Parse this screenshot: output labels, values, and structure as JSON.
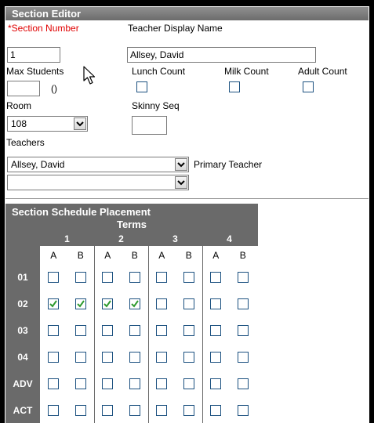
{
  "editor": {
    "title": "Section Editor",
    "section_number_label": "*Section Number",
    "section_number_value": "1",
    "teacher_display_label": "Teacher Display Name",
    "teacher_display_value": "Allsey, David",
    "max_students_label": "Max Students",
    "max_students_value": "",
    "max_students_count": "()",
    "lunch_count_label": "Lunch Count",
    "milk_count_label": "Milk Count",
    "adult_count_label": "Adult Count",
    "room_label": "Room",
    "room_value": "108",
    "skinny_seq_label": "Skinny Seq",
    "skinny_seq_value": "",
    "teachers_label": "Teachers",
    "teacher1_value": "Allsey, David",
    "primary_teacher_label": "Primary Teacher",
    "teacher2_value": ""
  },
  "schedule": {
    "title": "Section Schedule Placement",
    "terms_label": "Terms",
    "terms": [
      "1",
      "2",
      "3",
      "4"
    ],
    "subcols": [
      "A",
      "B",
      "A",
      "B",
      "A",
      "B",
      "A",
      "B"
    ],
    "periods": [
      "01",
      "02",
      "03",
      "04",
      "ADV",
      "ACT"
    ],
    "checked": {
      "01": [
        false,
        false,
        false,
        false,
        false,
        false,
        false,
        false
      ],
      "02": [
        true,
        true,
        true,
        true,
        false,
        false,
        false,
        false
      ],
      "03": [
        false,
        false,
        false,
        false,
        false,
        false,
        false,
        false
      ],
      "04": [
        false,
        false,
        false,
        false,
        false,
        false,
        false,
        false
      ],
      "ADV": [
        false,
        false,
        false,
        false,
        false,
        false,
        false,
        false
      ],
      "ACT": [
        false,
        false,
        false,
        false,
        false,
        false,
        false,
        false
      ]
    },
    "check_color": "#2e9a2e",
    "header_bg": "#6a6a6a"
  }
}
